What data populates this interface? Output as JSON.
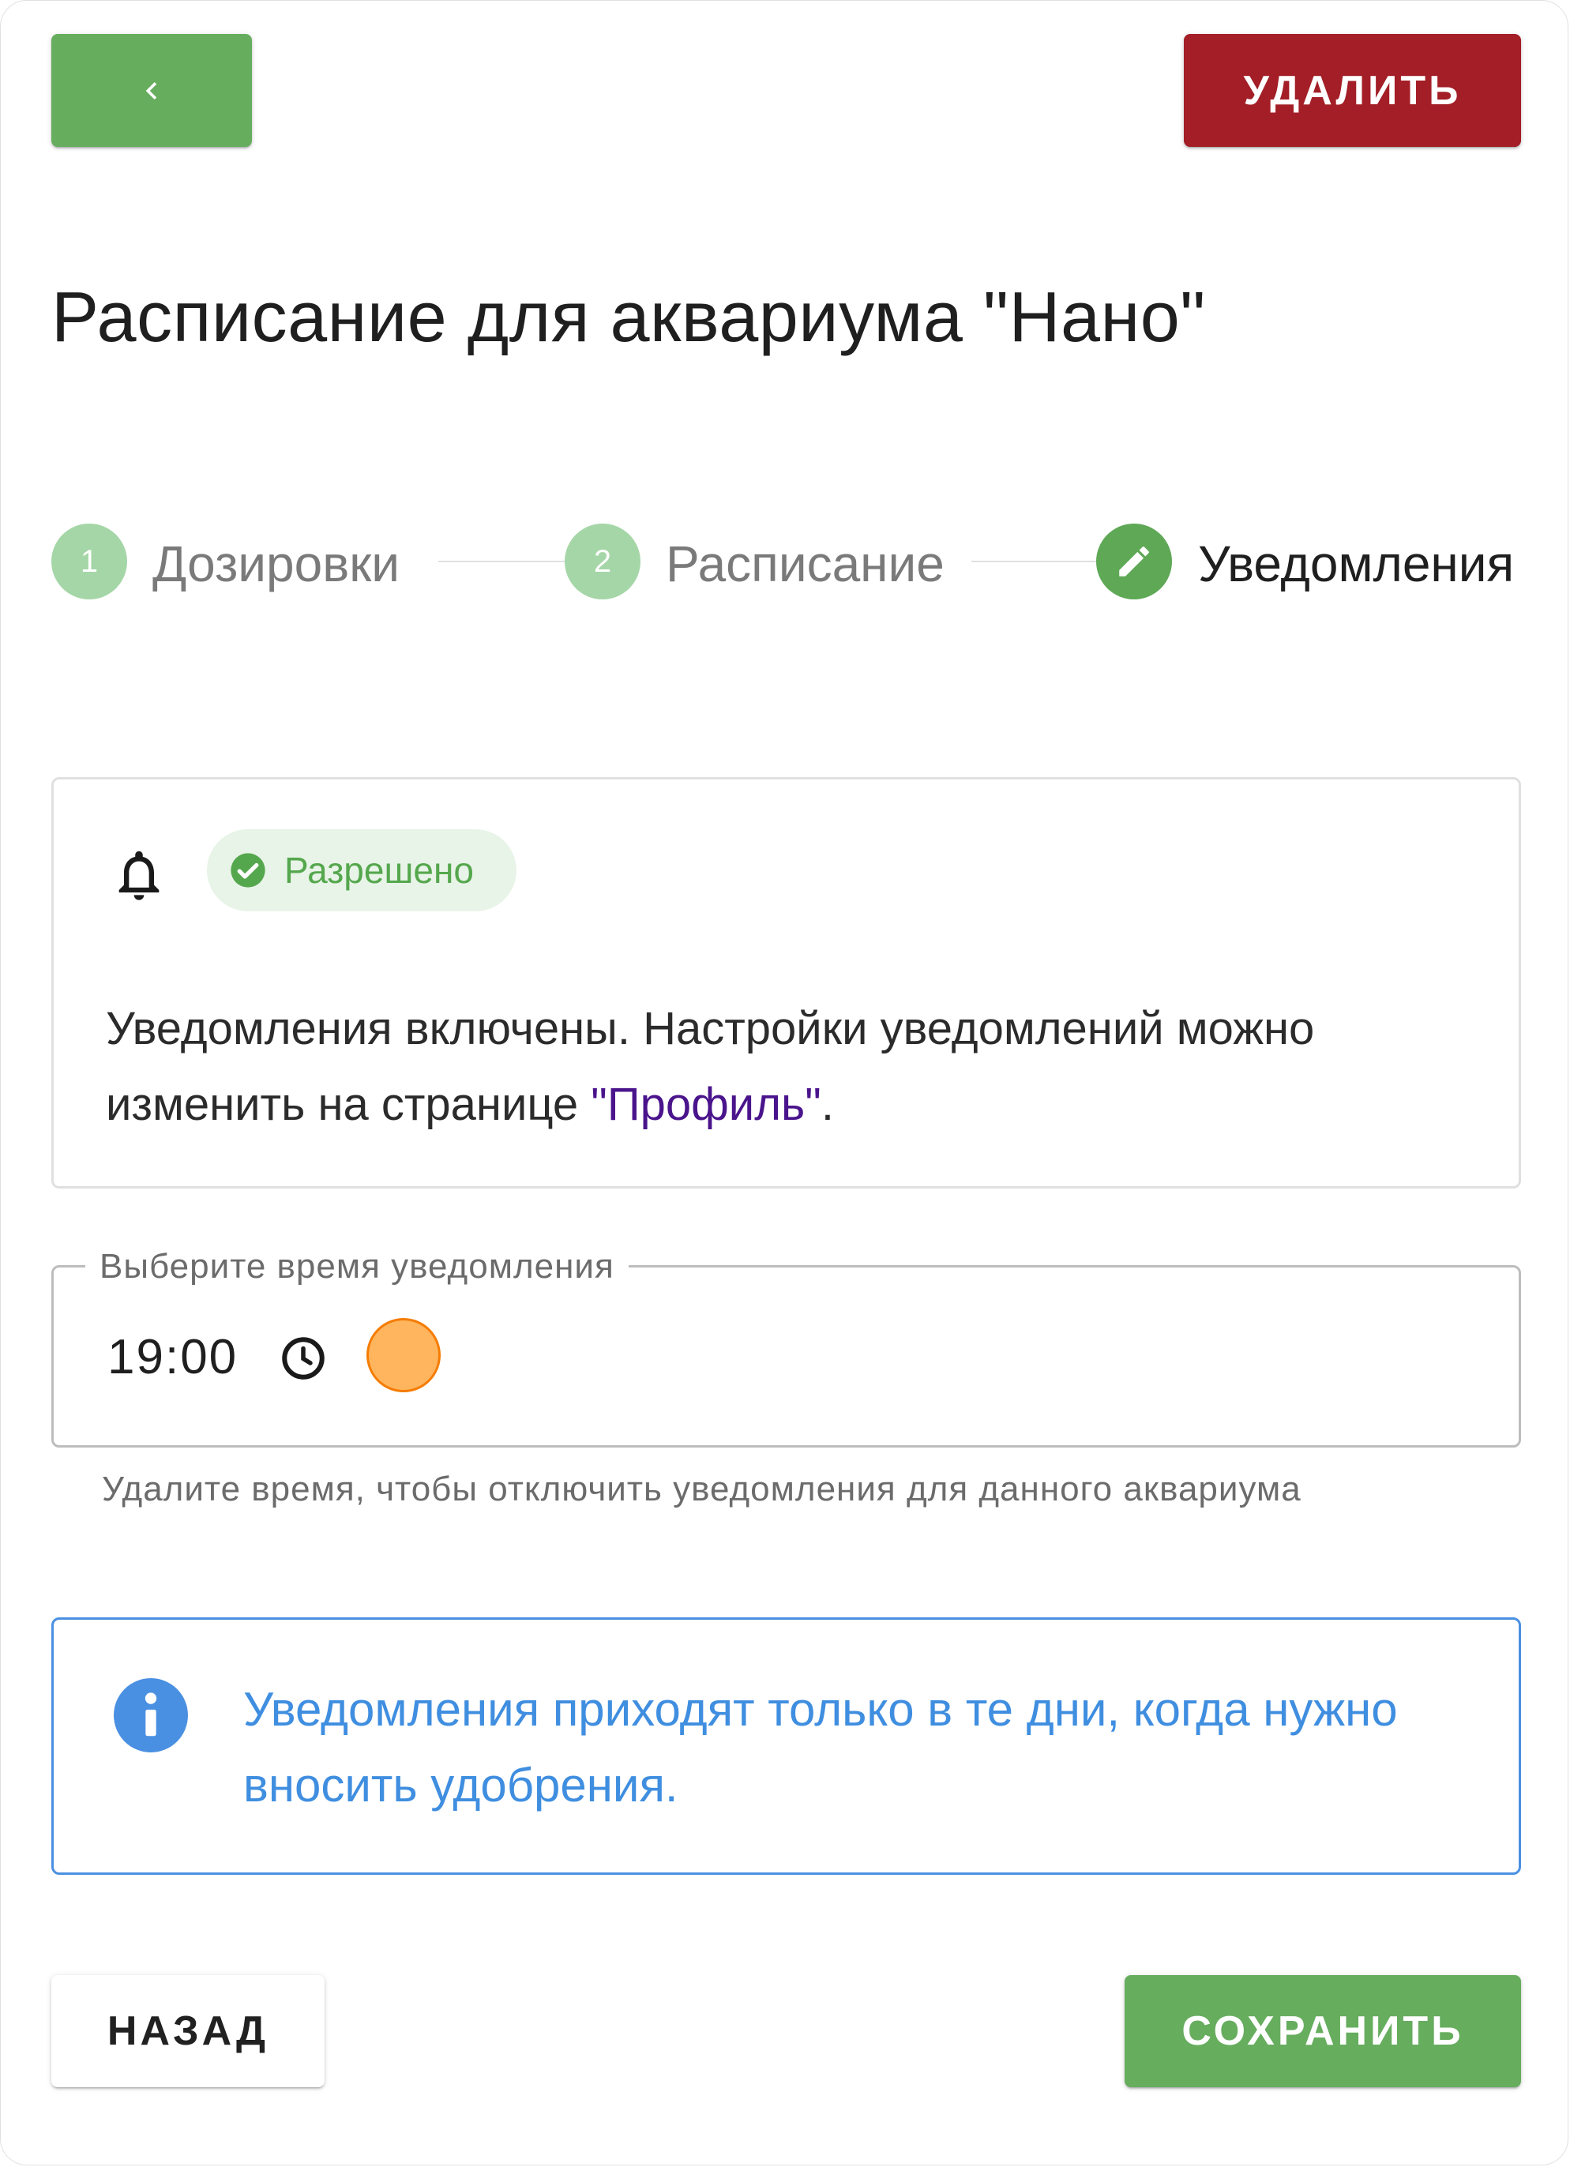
{
  "header": {
    "back_icon": "chevron-left-icon",
    "delete_label": "Удалить"
  },
  "title": "Расписание для аквариума \"Нано\"",
  "stepper": {
    "steps": [
      {
        "number": "1",
        "label": "Дозировки",
        "state": "completed"
      },
      {
        "number": "2",
        "label": "Расписание",
        "state": "completed"
      },
      {
        "number": "",
        "label": "Уведомления",
        "state": "active",
        "icon": "pencil-icon"
      }
    ]
  },
  "status_card": {
    "icon": "bell-icon",
    "chip_icon": "check-circle-icon",
    "chip_label": "Разрешено",
    "text_before_link": "Уведомления включены. Настройки уведомлений можно изменить на странице ",
    "link_text": "\"Профиль\"",
    "text_after_link": "."
  },
  "time_field": {
    "label": "Выберите время уведомления",
    "value": "19:00",
    "icon": "clock-icon",
    "helper": "Удалите время, чтобы отключить уведомления для данного аквариума"
  },
  "info_box": {
    "icon": "info-icon",
    "text": "Уведомления приходят только в те дни, когда нужно вносить удобрения."
  },
  "footer": {
    "back_label": "Назад",
    "save_label": "Сохранить"
  },
  "colors": {
    "primary_green": "#66ad5e",
    "danger_red": "#a31e26",
    "step_light_green": "#a5d6a7",
    "chip_green": "#55a74d",
    "link_purple": "#4a148c",
    "info_blue": "#4a90e2",
    "accent_orange": "#ffb55e"
  }
}
